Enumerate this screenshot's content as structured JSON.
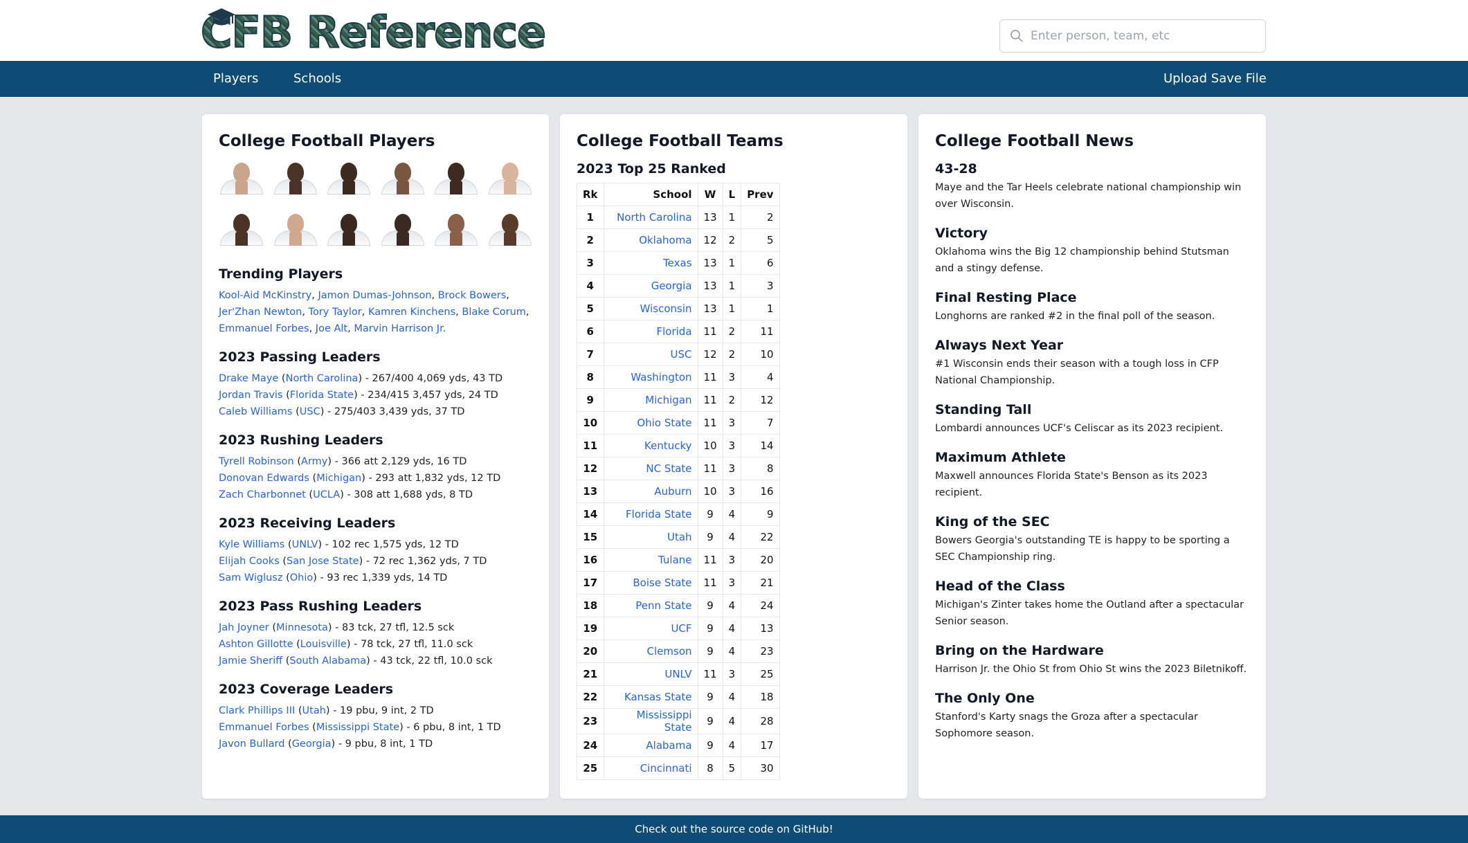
{
  "brand": {
    "logo_text": "CFB Reference"
  },
  "search": {
    "placeholder": "Enter person, team, etc",
    "icon": "search-icon"
  },
  "nav": {
    "players": "Players",
    "schools": "Schools",
    "upload": "Upload Save File"
  },
  "players_card": {
    "title": "College Football Players",
    "portraits": [
      {
        "skin": "#c9a58c"
      },
      {
        "skin": "#4a3326"
      },
      {
        "skin": "#3b2a20"
      },
      {
        "skin": "#7a5640"
      },
      {
        "skin": "#3e2b1f"
      },
      {
        "skin": "#d8b49c"
      },
      {
        "skin": "#4a3224"
      },
      {
        "skin": "#cfa88e"
      },
      {
        "skin": "#3a281e"
      },
      {
        "skin": "#3b2a22"
      },
      {
        "skin": "#8a6049"
      },
      {
        "skin": "#5a3c2b"
      }
    ],
    "trending": {
      "title": "Trending Players",
      "players": [
        "Kool-Aid McKinstry",
        "Jamon Dumas-Johnson",
        "Brock Bowers",
        "Jer'Zhan Newton",
        "Tory Taylor",
        "Kamren Kinchens",
        "Blake Corum",
        "Emmanuel Forbes",
        "Joe Alt",
        "Marvin Harrison Jr."
      ]
    },
    "leaders": [
      {
        "title": "2023 Passing Leaders",
        "rows": [
          {
            "name": "Drake Maye",
            "school": "North Carolina",
            "stat": "267/400 4,069 yds, 43 TD"
          },
          {
            "name": "Jordan Travis",
            "school": "Florida State",
            "stat": "234/415 3,457 yds, 24 TD"
          },
          {
            "name": "Caleb Williams",
            "school": "USC",
            "stat": "275/403 3,439 yds, 37 TD"
          }
        ]
      },
      {
        "title": "2023 Rushing Leaders",
        "rows": [
          {
            "name": "Tyrell Robinson",
            "school": "Army",
            "stat": "366 att 2,129 yds, 16 TD"
          },
          {
            "name": "Donovan Edwards",
            "school": "Michigan",
            "stat": "293 att 1,832 yds, 12 TD"
          },
          {
            "name": "Zach Charbonnet",
            "school": "UCLA",
            "stat": "308 att 1,688 yds, 8 TD"
          }
        ]
      },
      {
        "title": "2023 Receiving Leaders",
        "rows": [
          {
            "name": "Kyle Williams",
            "school": "UNLV",
            "stat": "102 rec 1,575 yds, 12 TD"
          },
          {
            "name": "Elijah Cooks",
            "school": "San Jose State",
            "stat": "72 rec 1,362 yds, 7 TD"
          },
          {
            "name": "Sam Wiglusz",
            "school": "Ohio",
            "stat": "93 rec 1,339 yds, 14 TD"
          }
        ]
      },
      {
        "title": "2023 Pass Rushing Leaders",
        "rows": [
          {
            "name": "Jah Joyner",
            "school": "Minnesota",
            "stat": "83 tck, 27 tfl, 12.5 sck"
          },
          {
            "name": "Ashton Gillotte",
            "school": "Louisville",
            "stat": "78 tck, 27 tfl, 11.0 sck"
          },
          {
            "name": "Jamie Sheriff",
            "school": "South Alabama",
            "stat": "43 tck, 22 tfl, 10.0 sck"
          }
        ]
      },
      {
        "title": "2023 Coverage Leaders",
        "rows": [
          {
            "name": "Clark Phillips III",
            "school": "Utah",
            "stat": "19 pbu, 9 int, 2 TD"
          },
          {
            "name": "Emmanuel Forbes",
            "school": "Mississippi State",
            "stat": "6 pbu, 8 int, 1 TD"
          },
          {
            "name": "Javon Bullard",
            "school": "Georgia",
            "stat": "9 pbu, 8 int, 1 TD"
          }
        ]
      }
    ]
  },
  "teams_card": {
    "title": "College Football Teams",
    "subtitle": "2023 Top 25 Ranked",
    "headers": [
      "Rk",
      "School",
      "W",
      "L",
      "Prev"
    ],
    "rows": [
      [
        "1",
        "North Carolina",
        "13",
        "1",
        "2"
      ],
      [
        "2",
        "Oklahoma",
        "12",
        "2",
        "5"
      ],
      [
        "3",
        "Texas",
        "13",
        "1",
        "6"
      ],
      [
        "4",
        "Georgia",
        "13",
        "1",
        "3"
      ],
      [
        "5",
        "Wisconsin",
        "13",
        "1",
        "1"
      ],
      [
        "6",
        "Florida",
        "11",
        "2",
        "11"
      ],
      [
        "7",
        "USC",
        "12",
        "2",
        "10"
      ],
      [
        "8",
        "Washington",
        "11",
        "3",
        "4"
      ],
      [
        "9",
        "Michigan",
        "11",
        "2",
        "12"
      ],
      [
        "10",
        "Ohio State",
        "11",
        "3",
        "7"
      ],
      [
        "11",
        "Kentucky",
        "10",
        "3",
        "14"
      ],
      [
        "12",
        "NC State",
        "11",
        "3",
        "8"
      ],
      [
        "13",
        "Auburn",
        "10",
        "3",
        "16"
      ],
      [
        "14",
        "Florida State",
        "9",
        "4",
        "9"
      ],
      [
        "15",
        "Utah",
        "9",
        "4",
        "22"
      ],
      [
        "16",
        "Tulane",
        "11",
        "3",
        "20"
      ],
      [
        "17",
        "Boise State",
        "11",
        "3",
        "21"
      ],
      [
        "18",
        "Penn State",
        "9",
        "4",
        "24"
      ],
      [
        "19",
        "UCF",
        "9",
        "4",
        "13"
      ],
      [
        "20",
        "Clemson",
        "9",
        "4",
        "23"
      ],
      [
        "21",
        "UNLV",
        "11",
        "3",
        "25"
      ],
      [
        "22",
        "Kansas State",
        "9",
        "4",
        "18"
      ],
      [
        "23",
        "Mississippi State",
        "9",
        "4",
        "28"
      ],
      [
        "24",
        "Alabama",
        "9",
        "4",
        "17"
      ],
      [
        "25",
        "Cincinnati",
        "8",
        "5",
        "30"
      ]
    ]
  },
  "news_card": {
    "title": "College Football News",
    "items": [
      {
        "headline": "43-28",
        "body": "Maye and the Tar Heels celebrate national championship win over Wisconsin."
      },
      {
        "headline": "Victory",
        "body": "Oklahoma wins the Big 12 championship behind Stutsman and a stingy defense."
      },
      {
        "headline": "Final Resting Place",
        "body": "Longhorns are ranked #2 in the final poll of the season."
      },
      {
        "headline": "Always Next Year",
        "body": "#1 Wisconsin ends their season with a tough loss in CFP National Championship."
      },
      {
        "headline": "Standing Tall",
        "body": "Lombardi announces UCF's Celiscar as its 2023 recipient."
      },
      {
        "headline": "Maximum Athlete",
        "body": "Maxwell announces Florida State's Benson as its 2023 recipient."
      },
      {
        "headline": "King of the SEC",
        "body": "Bowers Georgia's outstanding TE is happy to be sporting a SEC Championship ring."
      },
      {
        "headline": "Head of the Class",
        "body": "Michigan's Zinter takes home the Outland after a spectacular Senior season."
      },
      {
        "headline": "Bring on the Hardware",
        "body": "Harrison Jr. the Ohio St from Ohio St wins the 2023 Biletnikoff."
      },
      {
        "headline": "The Only One",
        "body": "Stanford's Karty snags the Groza after a spectacular Sophomore season."
      }
    ]
  },
  "footer": {
    "text": "Check out the source code on GitHub!"
  }
}
